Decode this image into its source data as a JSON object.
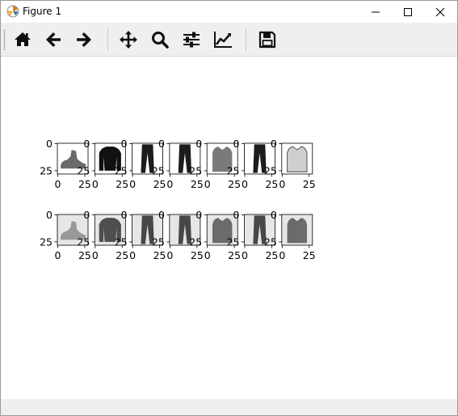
{
  "window": {
    "title": "Figure 1",
    "app_icon": "matplotlib-logo-icon",
    "controls": [
      "minimize-icon",
      "maximize-icon",
      "close-icon"
    ]
  },
  "toolbar": {
    "buttons": [
      {
        "name": "home-button",
        "icon": "home-icon"
      },
      {
        "name": "back-button",
        "icon": "arrow-left-icon"
      },
      {
        "name": "forward-button",
        "icon": "arrow-right-icon"
      },
      {
        "name": "pan-button",
        "icon": "move-arrows-icon"
      },
      {
        "name": "zoom-button",
        "icon": "magnifier-icon"
      },
      {
        "name": "configure-subplots-button",
        "icon": "sliders-icon"
      },
      {
        "name": "edit-axes-button",
        "icon": "line-chart-icon"
      },
      {
        "name": "save-button",
        "icon": "floppy-disk-icon"
      }
    ]
  },
  "figure": {
    "rows": [
      {
        "name": "original-images",
        "items": [
          "ankle boot",
          "pullover",
          "trouser",
          "trouser",
          "shirt",
          "trouser",
          "shirt"
        ],
        "y_ticks": [
          "0",
          "25"
        ],
        "x_ticks": [
          "0",
          "25"
        ]
      },
      {
        "name": "reconstructed-images",
        "items": [
          "ankle boot",
          "pullover",
          "trouser",
          "trouser",
          "shirt",
          "trouser",
          "shirt"
        ],
        "y_ticks": [
          "0",
          "25"
        ],
        "x_ticks": [
          "0",
          "25"
        ]
      }
    ]
  }
}
